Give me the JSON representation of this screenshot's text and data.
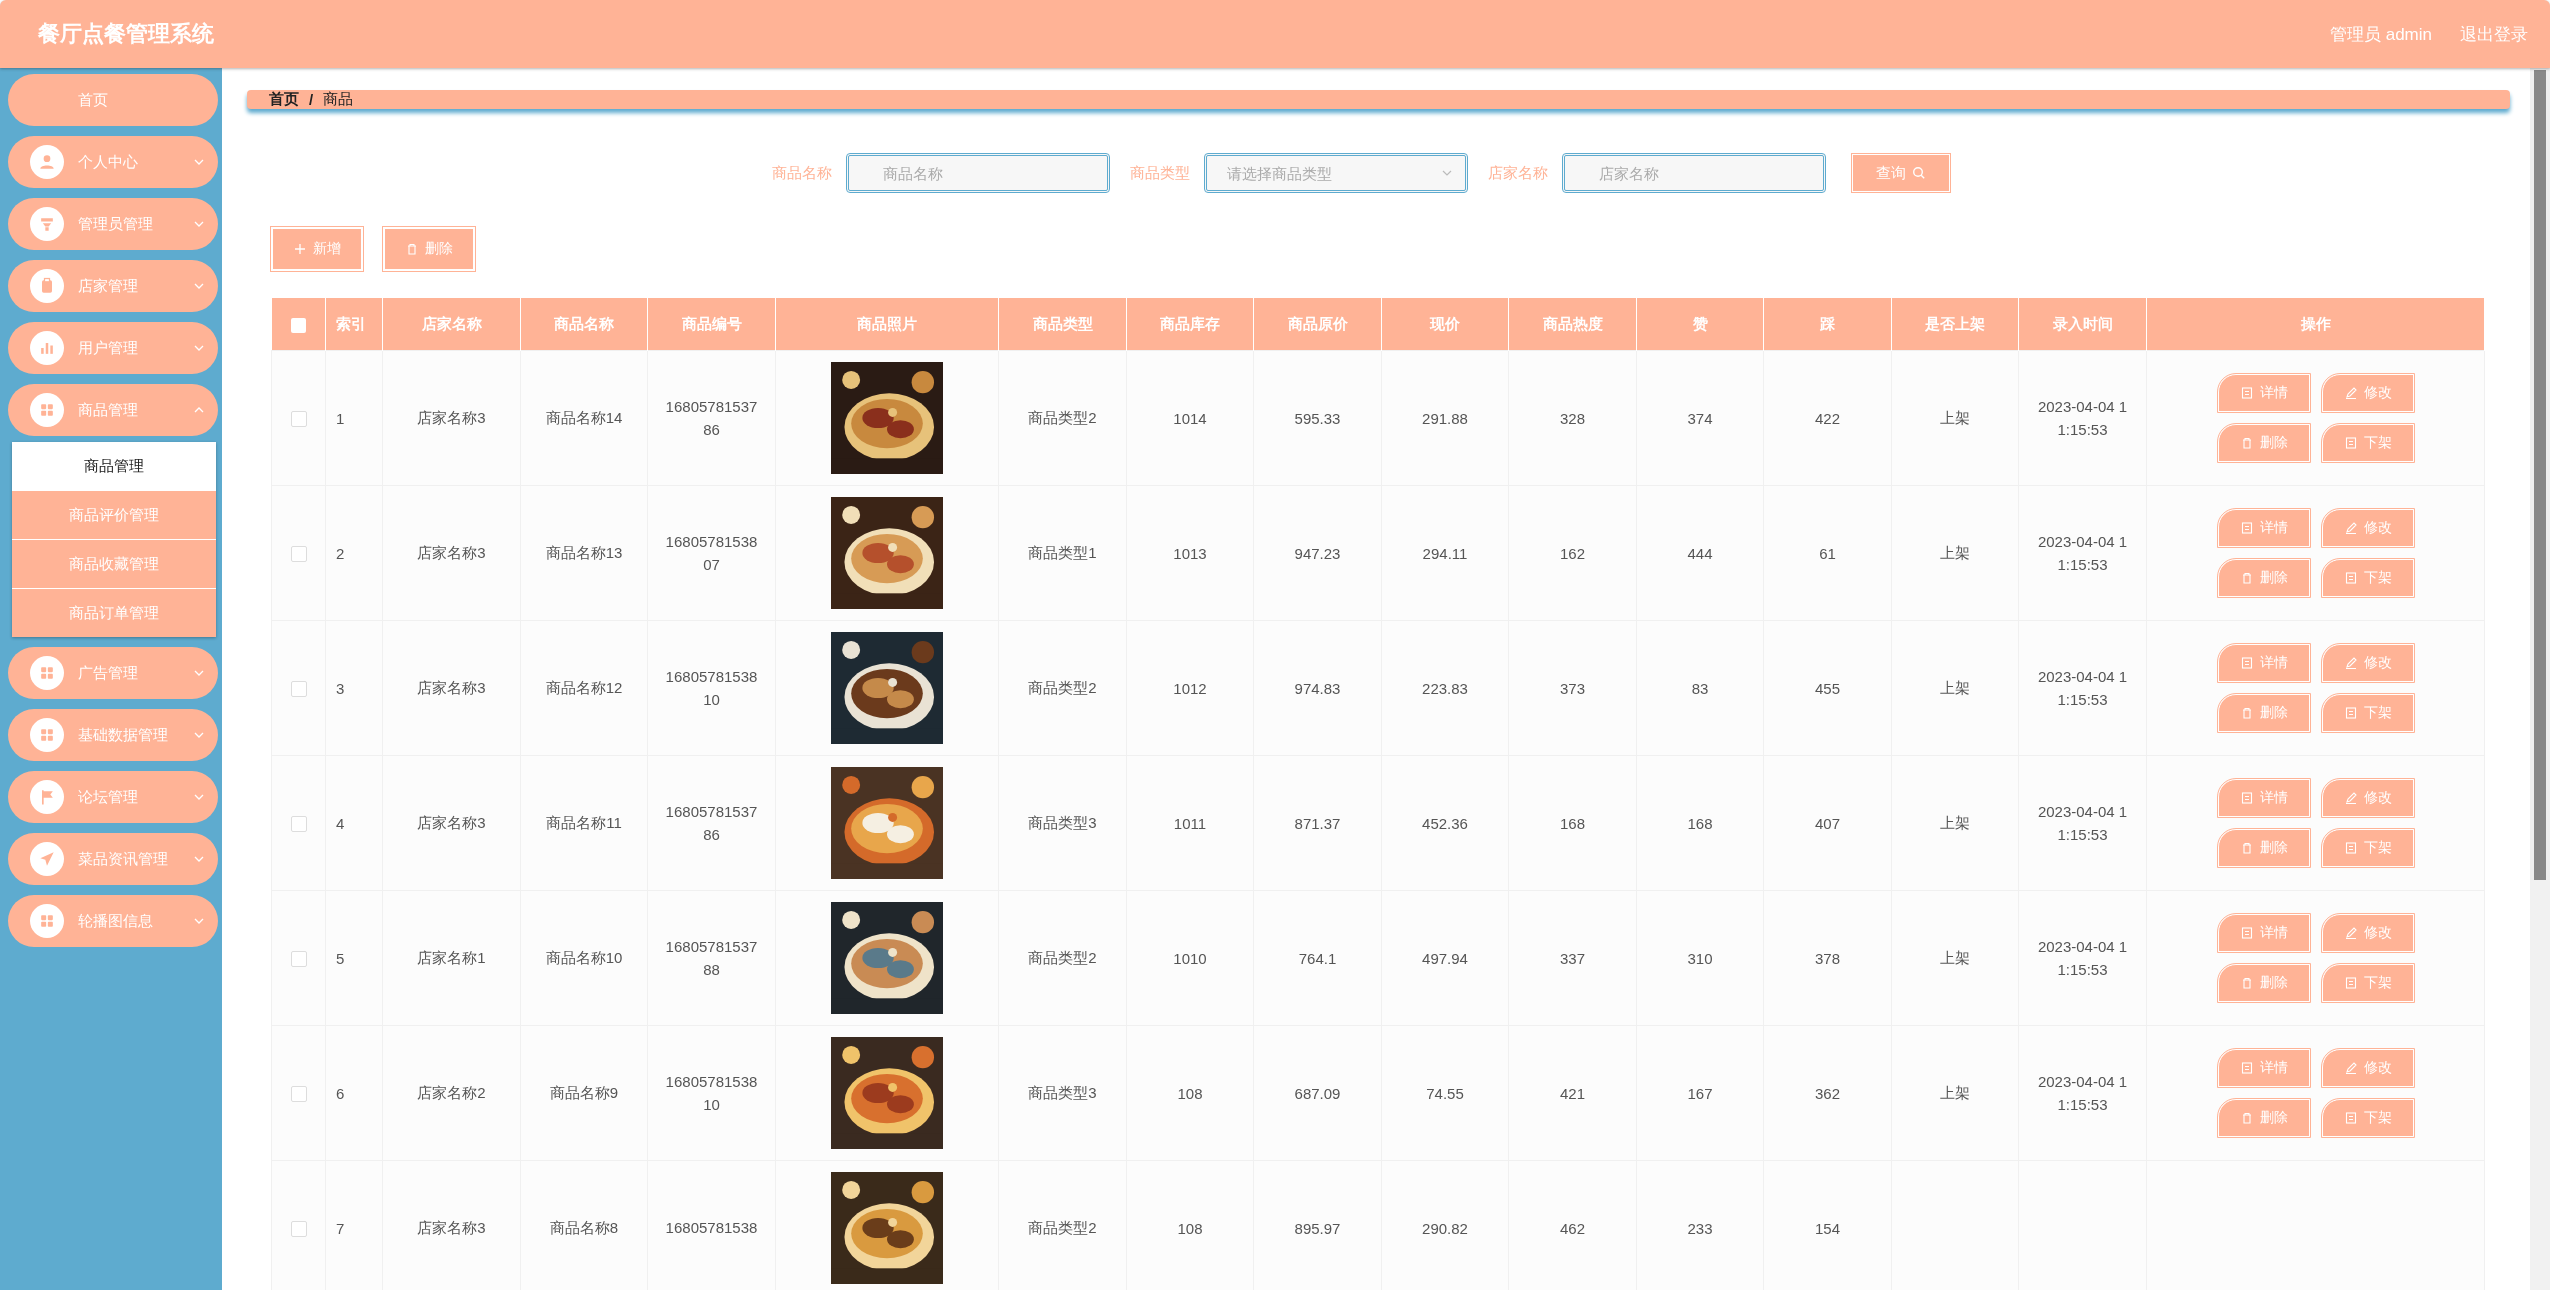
{
  "app_title": "餐厅点餐管理系统",
  "header": {
    "user": "管理员 admin",
    "logout": "退出登录"
  },
  "sidebar": {
    "items": [
      {
        "label": "首页",
        "selected": false
      },
      {
        "label": "个人中心",
        "kind": "person",
        "expanded": false
      },
      {
        "label": "管理员管理",
        "kind": "funnel",
        "expanded": false
      },
      {
        "label": "店家管理",
        "kind": "clipboard",
        "expanded": false
      },
      {
        "label": "用户管理",
        "kind": "chart",
        "expanded": false
      },
      {
        "label": "商品管理",
        "kind": "grid",
        "expanded": true,
        "children": [
          {
            "label": "商品管理",
            "selected": true
          },
          {
            "label": "商品评价管理",
            "selected": false
          },
          {
            "label": "商品收藏管理",
            "selected": false
          },
          {
            "label": "商品订单管理",
            "selected": false
          }
        ]
      },
      {
        "label": "广告管理",
        "kind": "grid",
        "expanded": false
      },
      {
        "label": "基础数据管理",
        "kind": "grid",
        "expanded": false
      },
      {
        "label": "论坛管理",
        "kind": "flag",
        "expanded": false
      },
      {
        "label": "菜品资讯管理",
        "kind": "plane",
        "expanded": false
      },
      {
        "label": "轮播图信息",
        "kind": "grid",
        "expanded": false
      }
    ]
  },
  "breadcrumb": {
    "separator": "/",
    "items": [
      "首页",
      "商品"
    ]
  },
  "search": {
    "fields": [
      {
        "kind": "input",
        "label": "商品名称",
        "placeholder": "商品名称"
      },
      {
        "kind": "select",
        "label": "商品类型",
        "placeholder": "请选择商品类型"
      },
      {
        "kind": "input",
        "label": "店家名称",
        "placeholder": "店家名称"
      }
    ],
    "button": "查询"
  },
  "toolbar": [
    {
      "kind": "add",
      "label": "新增"
    },
    {
      "kind": "delete",
      "label": "删除"
    }
  ],
  "table": {
    "all_checked": false,
    "columns": [
      "索引",
      "店家名称",
      "商品名称",
      "商品编号",
      "商品照片",
      "商品类型",
      "商品库存",
      "商品原价",
      "现价",
      "商品热度",
      "赞",
      "踩",
      "是否上架",
      "录入时间",
      "操作"
    ],
    "rows": [
      {
        "checked": false,
        "cells": [
          "1",
          "店家名称3",
          "商品名称14",
          "1680578153786",
          {
            "kind": "picture"
          },
          "商品类型2",
          "1014",
          "595.33",
          "291.88",
          "328",
          "374",
          "422",
          "上架",
          "2023-04-04 11:15:53"
        ],
        "actions": [
          "详情",
          "修改",
          "删除",
          "下架"
        ]
      },
      {
        "checked": false,
        "cells": [
          "2",
          "店家名称3",
          "商品名称13",
          "1680578153807",
          {
            "kind": "picture"
          },
          "商品类型1",
          "1013",
          "947.23",
          "294.11",
          "162",
          "444",
          "61",
          "上架",
          "2023-04-04 11:15:53"
        ],
        "actions": [
          "详情",
          "修改",
          "删除",
          "下架"
        ]
      },
      {
        "checked": false,
        "cells": [
          "3",
          "店家名称3",
          "商品名称12",
          "1680578153810",
          {
            "kind": "picture"
          },
          "商品类型2",
          "1012",
          "974.83",
          "223.83",
          "373",
          "83",
          "455",
          "上架",
          "2023-04-04 11:15:53"
        ],
        "actions": [
          "详情",
          "修改",
          "删除",
          "下架"
        ]
      },
      {
        "checked": false,
        "cells": [
          "4",
          "店家名称3",
          "商品名称11",
          "1680578153786",
          {
            "kind": "picture"
          },
          "商品类型3",
          "1011",
          "871.37",
          "452.36",
          "168",
          "168",
          "407",
          "上架",
          "2023-04-04 11:15:53"
        ],
        "actions": [
          "详情",
          "修改",
          "删除",
          "下架"
        ]
      },
      {
        "checked": false,
        "cells": [
          "5",
          "店家名称1",
          "商品名称10",
          "1680578153788",
          {
            "kind": "picture"
          },
          "商品类型2",
          "1010",
          "764.1",
          "497.94",
          "337",
          "310",
          "378",
          "上架",
          "2023-04-04 11:15:53"
        ],
        "actions": [
          "详情",
          "修改",
          "删除",
          "下架"
        ]
      },
      {
        "checked": false,
        "cells": [
          "6",
          "店家名称2",
          "商品名称9",
          "1680578153810",
          {
            "kind": "picture"
          },
          "商品类型3",
          "108",
          "687.09",
          "74.55",
          "421",
          "167",
          "362",
          "上架",
          "2023-04-04 11:15:53"
        ],
        "actions": [
          "详情",
          "修改",
          "删除",
          "下架"
        ]
      },
      {
        "checked": false,
        "cells": [
          "7",
          "店家名称3",
          "商品名称8",
          "16805781538",
          {
            "kind": "picture"
          },
          "商品类型2",
          "108",
          "895.97",
          "290.82",
          "462",
          "233",
          "154"
        ]
      }
    ]
  }
}
